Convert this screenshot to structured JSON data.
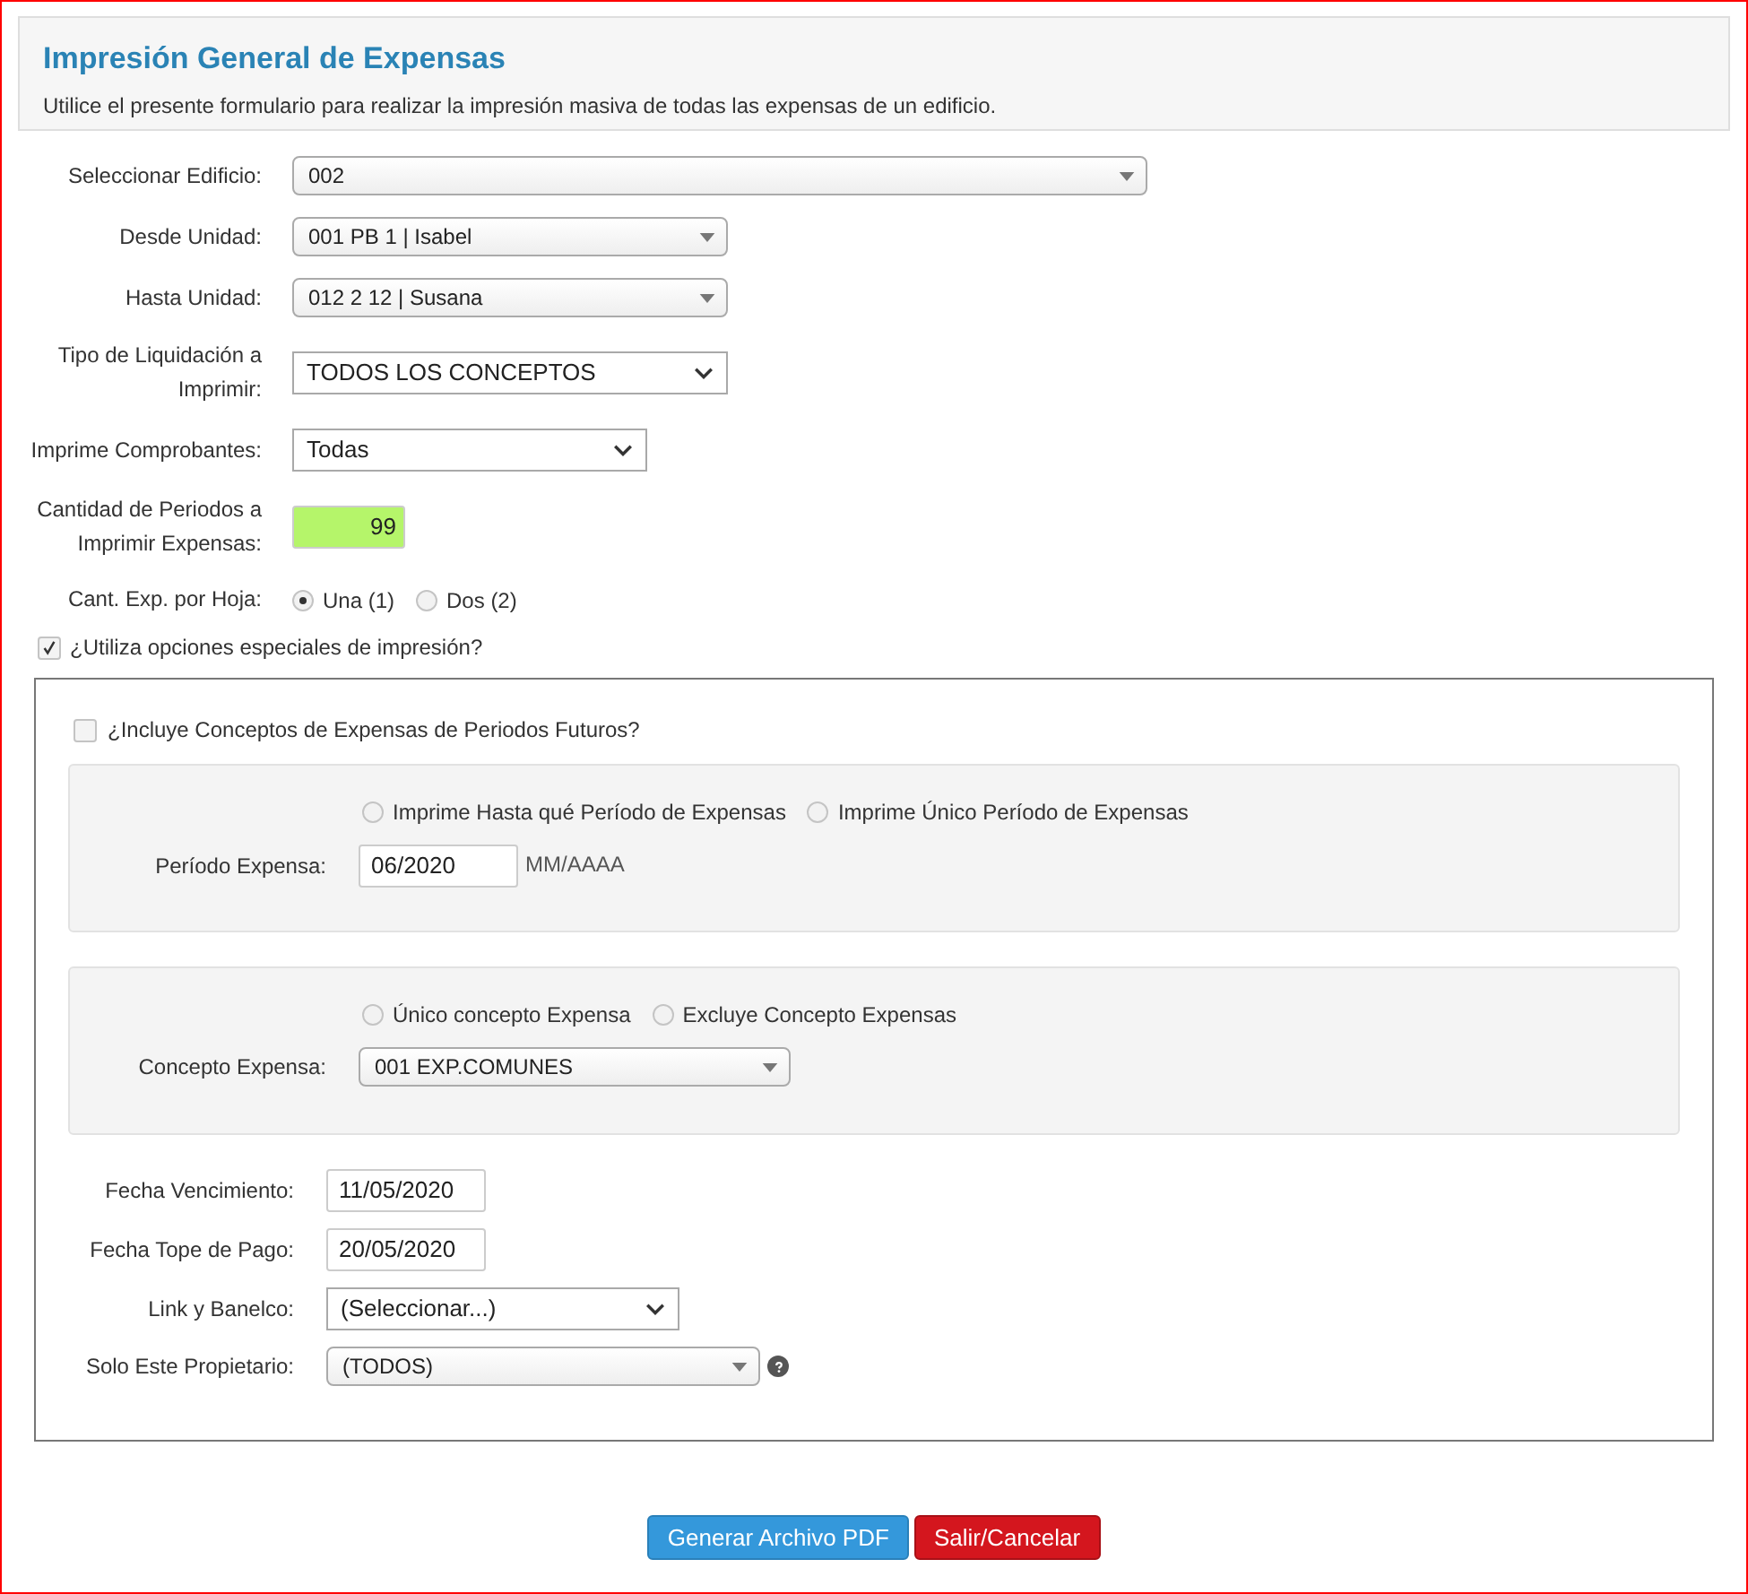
{
  "header": {
    "title": "Impresión General de Expensas",
    "description": "Utilice el presente formulario para realizar la impresión masiva de todas las expensas de un edificio."
  },
  "fields": [
    {
      "label": "Seleccionar Edificio:",
      "kind": "combo",
      "value": "002"
    },
    {
      "label": "Desde Unidad:",
      "kind": "combo",
      "value": "001 PB 1 | Isabel"
    },
    {
      "label": "Hasta Unidad:",
      "kind": "combo",
      "value": "012 2 12 | Susana"
    },
    {
      "label": "Tipo de Liquidación a Imprimir:",
      "kind": "native",
      "value": "TODOS LOS CONCEPTOS"
    },
    {
      "label": "Imprime Comprobantes:",
      "kind": "native",
      "value": "Todas"
    },
    {
      "label": "Cantidad de Periodos a Imprimir Expensas:",
      "kind": "number",
      "value": "99"
    },
    {
      "label": "Cant. Exp. por Hoja:",
      "kind": "radios",
      "options": [
        {
          "label": "Una (1)",
          "selected": true
        },
        {
          "label": "Dos (2)",
          "selected": false
        }
      ]
    }
  ],
  "special": {
    "label": "¿Utiliza opciones especiales de impresión?",
    "checked": true,
    "future": {
      "label": "¿Incluye Conceptos de Expensas de Periodos Futuros?",
      "checked": false
    },
    "groups": [
      {
        "options": [
          {
            "label": "Imprime Hasta qué Período de Expensas",
            "selected": false
          },
          {
            "label": "Imprime Único Período de Expensas",
            "selected": false
          }
        ],
        "field": {
          "label": "Período Expensa:",
          "kind": "text",
          "value": "06/2020",
          "hint": "MM/AAAA"
        }
      },
      {
        "options": [
          {
            "label": "Único concepto Expensa",
            "selected": false
          },
          {
            "label": "Excluye Concepto Expensas",
            "selected": false
          }
        ],
        "field": {
          "label": "Concepto Expensa:",
          "kind": "combo",
          "value": "001 EXP.COMUNES"
        }
      }
    ],
    "fields": [
      {
        "label": "Fecha Vencimiento:",
        "kind": "text",
        "value": "11/05/2020"
      },
      {
        "label": "Fecha Tope de Pago:",
        "kind": "text",
        "value": "20/05/2020"
      },
      {
        "label": "Link y Banelco:",
        "kind": "native",
        "value": "(Seleccionar...)"
      },
      {
        "label": "Solo Este Propietario:",
        "kind": "combo",
        "value": "(TODOS)",
        "help": true
      }
    ]
  },
  "buttons": [
    {
      "label": "Generar Archivo PDF",
      "kind": "primary"
    },
    {
      "label": "Salir/Cancelar",
      "kind": "danger"
    }
  ]
}
